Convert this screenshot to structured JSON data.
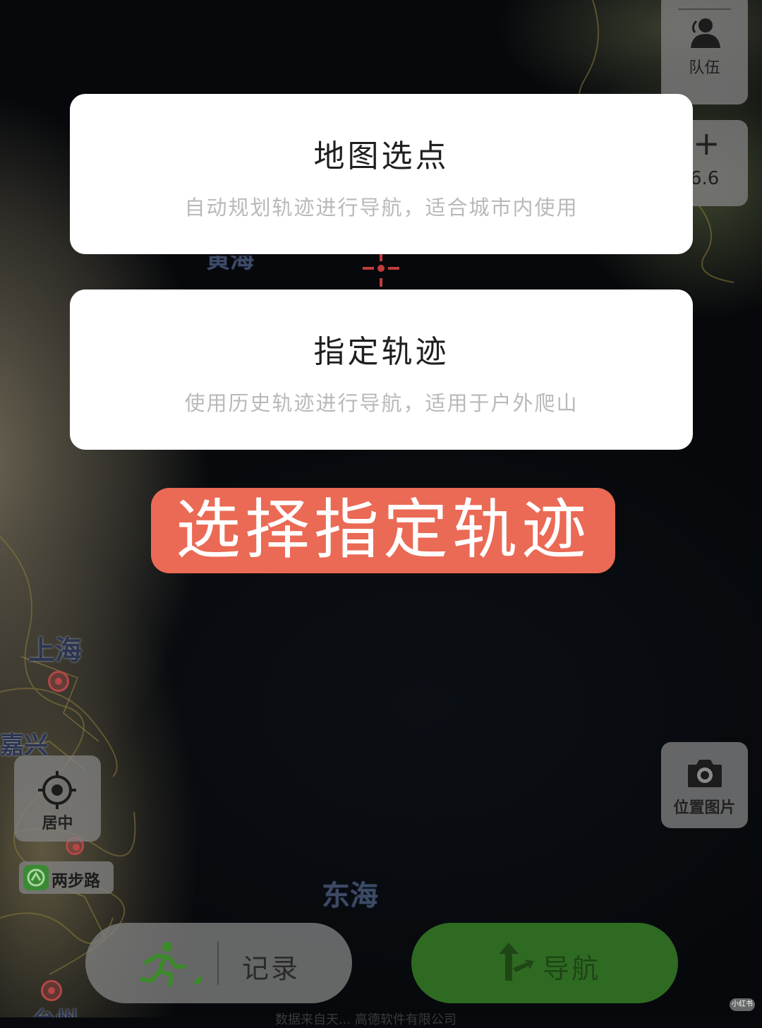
{
  "map": {
    "labels": {
      "yellow_sea_partial": "黄海",
      "shanghai": "上海",
      "jiaxing": "嘉兴",
      "east_sea": "东海",
      "city_bottom": "台州"
    },
    "attribution": "数据来自天... 高德软件有限公司",
    "watermark": "小红书"
  },
  "controls": {
    "team_label": "队伍",
    "zoom_plus": "+",
    "zoom_level": "6.6",
    "center_label": "居中",
    "photo_label": "位置图片",
    "two_step_label": "两步路"
  },
  "actions": {
    "record_label": "记录",
    "navigate_label": "导航"
  },
  "options": [
    {
      "title": "地图选点",
      "subtitle": "自动规划轨迹进行导航，适合城市内使用"
    },
    {
      "title": "指定轨迹",
      "subtitle": "使用历史轨迹进行导航，适用于户外爬山"
    }
  ],
  "annotation": {
    "text": "选择指定轨迹"
  },
  "colors": {
    "navigate_green": "#2f6a22",
    "banner_coral": "#ea6a55",
    "control_gray": "#808080",
    "card_white": "#ffffff"
  }
}
